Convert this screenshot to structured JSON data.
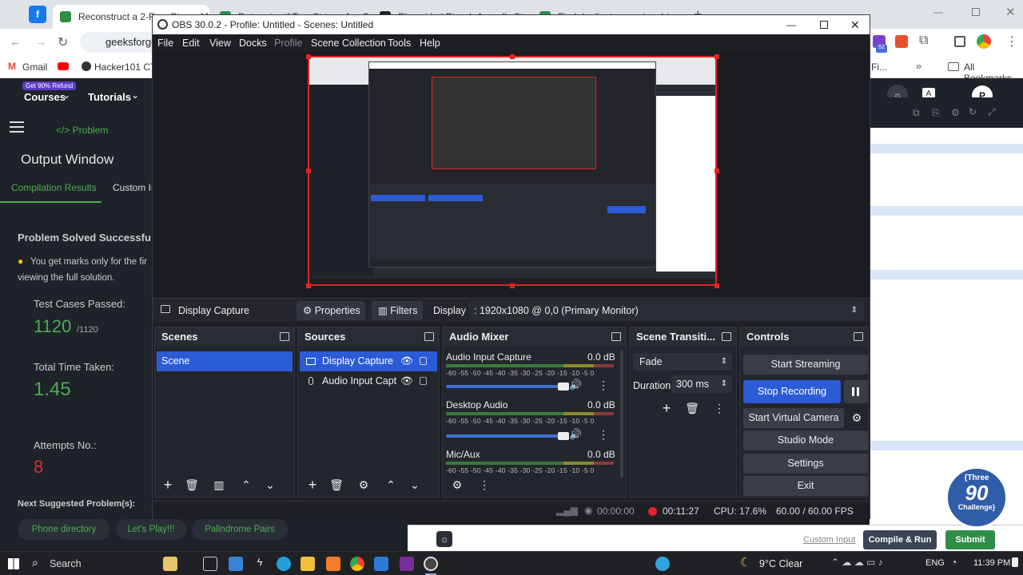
{
  "browser": {
    "tabs": [
      "Reconstruct a 2-Row Binary Ma",
      "Determine if Two Strings Are C",
      "Riverside | Piyush Anand's Stu",
      "Find duplicate rows in a binary"
    ],
    "address": "geeksforge",
    "bookmarks": [
      "Gmail",
      "Hacker101 CTF"
    ],
    "bookmarks_right": [
      "Fi...",
      "All Bookmarks"
    ],
    "avatar": "P",
    "ext_badge": "52"
  },
  "gfg": {
    "promo": "Get 90% Refund",
    "nav": [
      "Courses",
      "Tutorials"
    ],
    "problem_tab": "</> Problem",
    "output_title": "Output Window",
    "tabs": [
      "Compilation Results",
      "Custom In"
    ],
    "solved": "Problem Solved Successfu",
    "note1": "You get marks only for the fir",
    "note2": "viewing the full solution.",
    "tests_label": "Test Cases Passed:",
    "tests_value": "1120",
    "tests_total": "/1120",
    "time_label": "Total Time Taken:",
    "time_value": "1.45",
    "attempts_label": "Attempts No.:",
    "attempts_value": "8",
    "next_label": "Next Suggested Problem(s):",
    "suggestions": [
      "Phone directory",
      "Let's Play!!!",
      "Palindrome Pairs"
    ],
    "custom_input": "Custom Input",
    "compile": "Compile & Run",
    "submit": "Submit",
    "badge": [
      "{Three",
      "90",
      "Challenge}"
    ]
  },
  "obs": {
    "title": "OBS 30.0.2 - Profile: Untitled - Scenes: Untitled",
    "menu": [
      "File",
      "Edit",
      "View",
      "Docks",
      "Profile",
      "Scene Collection",
      "Tools",
      "Help"
    ],
    "context": {
      "source": "Display Capture",
      "properties": "Properties",
      "filters": "Filters",
      "display_label": "Display",
      "display_value": ": 1920x1080 @ 0,0 (Primary Monitor)"
    },
    "scenes": {
      "title": "Scenes",
      "items": [
        "Scene"
      ]
    },
    "sources": {
      "title": "Sources",
      "items": [
        "Display Capture",
        "Audio Input Captu"
      ]
    },
    "mixer": {
      "title": "Audio Mixer",
      "channels": [
        {
          "name": "Audio Input Capture",
          "db": "0.0 dB"
        },
        {
          "name": "Desktop Audio",
          "db": "0.0 dB"
        },
        {
          "name": "Mic/Aux",
          "db": "0.0 dB"
        }
      ],
      "scale": "-60 -55 -50 -45 -40 -35 -30 -25 -20 -15 -10 -5 0"
    },
    "transitions": {
      "title": "Scene Transiti...",
      "type": "Fade",
      "duration_label": "Duration",
      "duration_value": "300 ms"
    },
    "controls": {
      "title": "Controls",
      "buttons": [
        "Start Streaming",
        "Stop Recording",
        "Start Virtual Camera",
        "Studio Mode",
        "Settings",
        "Exit"
      ]
    },
    "status": {
      "stream_time": "00:00:00",
      "rec_time": "00:11:27",
      "cpu": "CPU: 17.6%",
      "fps": "60.00 / 60.00 FPS"
    }
  },
  "taskbar": {
    "search": "Search",
    "weather": "9°C  Clear",
    "lang": "ENG",
    "time": "11:39 PM"
  },
  "colors": {
    "obs_bg": "#1e1f24",
    "accent_blue": "#2c5bd6",
    "gfg_green": "#2f8d46",
    "rec_red": "#e02424"
  }
}
